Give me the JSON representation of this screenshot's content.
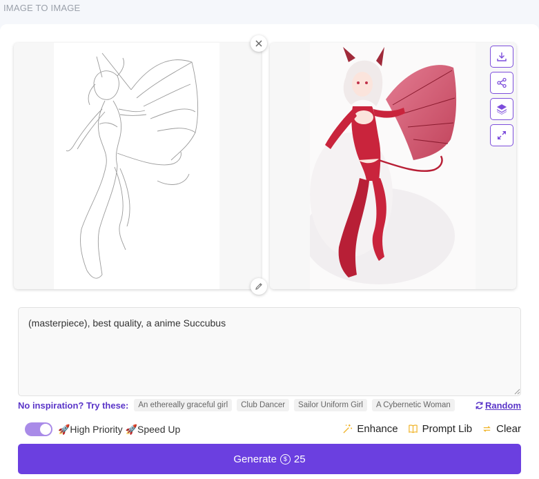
{
  "section": {
    "title": "IMAGE TO IMAGE"
  },
  "prompt": {
    "value": "(masterpiece), best quality, a anime Succubus"
  },
  "inspiration": {
    "label": "No inspiration? Try these:",
    "chips": [
      "An ethereally graceful girl",
      "Club Dancer",
      "Sailor Uniform Girl",
      "A Cybernetic Woman"
    ],
    "random_label": "Random"
  },
  "options": {
    "priority_label": "🚀High Priority 🚀Speed Up",
    "priority_enabled": true
  },
  "tools": {
    "enhance": "Enhance",
    "prompt_lib": "Prompt Lib",
    "clear": "Clear"
  },
  "generate": {
    "label": "Generate",
    "coin_symbol": "$",
    "cost": "25"
  },
  "icons": {
    "close": "close-icon",
    "edit": "pencil-icon",
    "download": "download-icon",
    "share": "share-icon",
    "layers": "layers-icon",
    "expand": "expand-icon"
  },
  "colors": {
    "accent": "#6b3fe0",
    "accent_light": "#a98be8",
    "tool_icon": "#f0b429"
  }
}
